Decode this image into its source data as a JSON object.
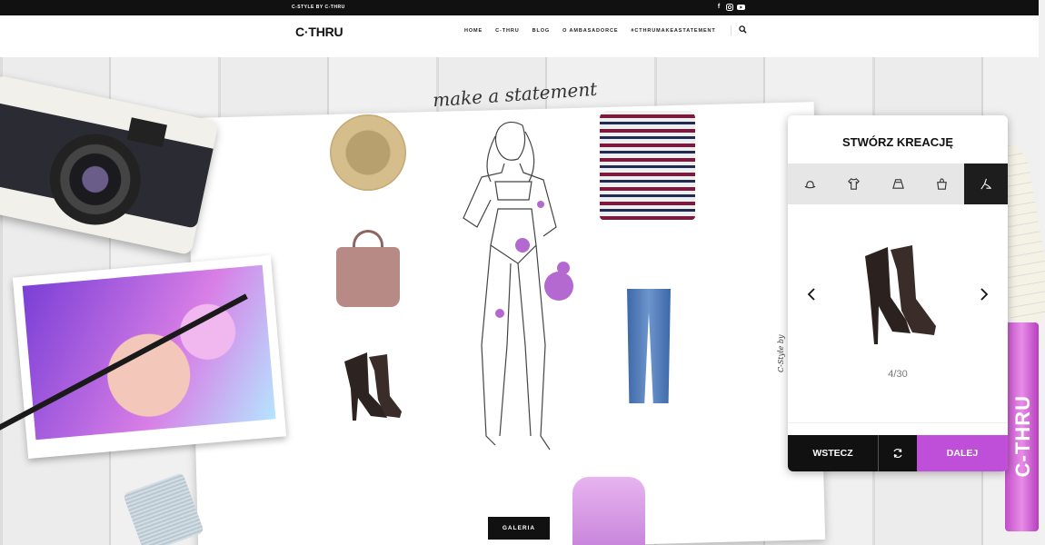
{
  "topbar": {
    "tagline": "C-STYLE BY C-THRU",
    "social_icons": [
      "facebook-icon",
      "instagram-icon",
      "youtube-icon"
    ]
  },
  "nav": {
    "logo": "C·THRU",
    "items": [
      "HOME",
      "C-THRU",
      "BLOG",
      "O AMBASADORCE",
      "#CTHRUMAKEASTATEMENT"
    ],
    "search_icon": "search-icon"
  },
  "hero": {
    "tagline": "make a statement",
    "credit": "C-Style by",
    "gallery_button": "GALERIA",
    "perfume_label": "C-THRU",
    "pieces": [
      "hat",
      "bag",
      "boots",
      "shirt",
      "jeans",
      "fashion-sketch"
    ]
  },
  "creator": {
    "title": "STWÓRZ KREACJĘ",
    "categories": [
      {
        "icon": "hat-icon",
        "active": false
      },
      {
        "icon": "tshirt-icon",
        "active": false
      },
      {
        "icon": "skirt-icon",
        "active": false
      },
      {
        "icon": "bag-icon",
        "active": false
      },
      {
        "icon": "shoe-icon",
        "active": true
      }
    ],
    "current_item": "boots",
    "counter": "4/30",
    "back_label": "WSTECZ",
    "reset_icon": "refresh-icon",
    "next_label": "DALEJ"
  },
  "colors": {
    "accent": "#bf4fd9",
    "dark": "#111111"
  }
}
